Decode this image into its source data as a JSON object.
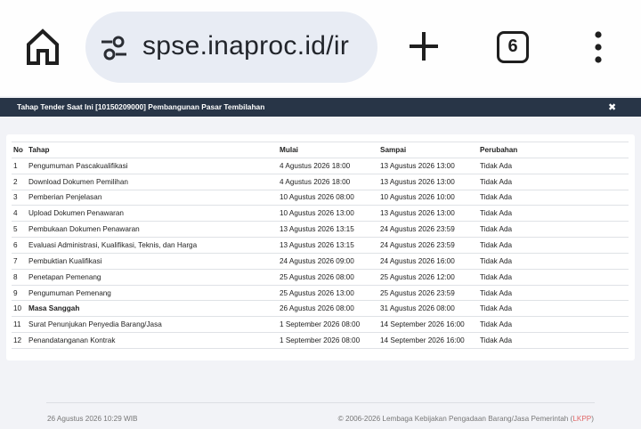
{
  "browser": {
    "url_text": "spse.inaproc.id/ir",
    "tab_count": "6",
    "icons": [
      "home-icon",
      "tune-icon",
      "plus-icon",
      "tabs-icon",
      "more-vert-icon"
    ]
  },
  "dialog": {
    "title": "Tahap Tender Saat Ini [10150209000] Pembangunan Pasar Tembilahan",
    "close_glyph": "✖"
  },
  "table": {
    "headers": {
      "no": "No",
      "tahap": "Tahap",
      "mulai": "Mulai",
      "sampai": "Sampai",
      "perubahan": "Perubahan"
    },
    "rows": [
      {
        "no": "1",
        "tahap": "Pengumuman Pascakualifikasi",
        "mulai": "4 Agustus 2026 18:00",
        "sampai": "13 Agustus 2026 13:00",
        "perubahan": "Tidak Ada"
      },
      {
        "no": "2",
        "tahap": "Download Dokumen Pemilihan",
        "mulai": "4 Agustus 2026 18:00",
        "sampai": "13 Agustus 2026 13:00",
        "perubahan": "Tidak Ada"
      },
      {
        "no": "3",
        "tahap": "Pemberian Penjelasan",
        "mulai": "10 Agustus 2026 08:00",
        "sampai": "10 Agustus 2026 10:00",
        "perubahan": "Tidak Ada"
      },
      {
        "no": "4",
        "tahap": "Upload Dokumen Penawaran",
        "mulai": "10 Agustus 2026 13:00",
        "sampai": "13 Agustus 2026 13:00",
        "perubahan": "Tidak Ada"
      },
      {
        "no": "5",
        "tahap": "Pembukaan Dokumen Penawaran",
        "mulai": "13 Agustus 2026 13:15",
        "sampai": "24 Agustus 2026 23:59",
        "perubahan": "Tidak Ada"
      },
      {
        "no": "6",
        "tahap": "Evaluasi Administrasi, Kualifikasi, Teknis, dan Harga",
        "mulai": "13 Agustus 2026 13:15",
        "sampai": "24 Agustus 2026 23:59",
        "perubahan": "Tidak Ada"
      },
      {
        "no": "7",
        "tahap": "Pembuktian Kualifikasi",
        "mulai": "24 Agustus 2026 09:00",
        "sampai": "24 Agustus 2026 16:00",
        "perubahan": "Tidak Ada"
      },
      {
        "no": "8",
        "tahap": "Penetapan Pemenang",
        "mulai": "25 Agustus 2026 08:00",
        "sampai": "25 Agustus 2026 12:00",
        "perubahan": "Tidak Ada"
      },
      {
        "no": "9",
        "tahap": "Pengumuman Pemenang",
        "mulai": "25 Agustus 2026 13:00",
        "sampai": "25 Agustus 2026 23:59",
        "perubahan": "Tidak Ada"
      },
      {
        "no": "10",
        "tahap": "Masa Sanggah",
        "mulai": "26 Agustus 2026 08:00",
        "sampai": "31 Agustus 2026 08:00",
        "perubahan": "Tidak Ada",
        "current": true
      },
      {
        "no": "11",
        "tahap": "Surat Penunjukan Penyedia Barang/Jasa",
        "mulai": "1 September 2026 08:00",
        "sampai": "14 September 2026 16:00",
        "perubahan": "Tidak Ada"
      },
      {
        "no": "12",
        "tahap": "Penandatanganan Kontrak",
        "mulai": "1 September 2026 08:00",
        "sampai": "14 September 2026 16:00",
        "perubahan": "Tidak Ada"
      }
    ]
  },
  "footer": {
    "datetime": "26 Agustus 2026 10:29 WIB",
    "copyright_prefix": "© 2006-2026 Lembaga Kebijakan Pengadaan Barang/Jasa Pemerintah (",
    "copyright_link": "LKPP",
    "copyright_suffix": ")"
  },
  "colors": {
    "title_bar": "#283547",
    "browser_pill": "#e8ecf4",
    "page_bg": "#f2f3f7",
    "link": "#e06666"
  }
}
